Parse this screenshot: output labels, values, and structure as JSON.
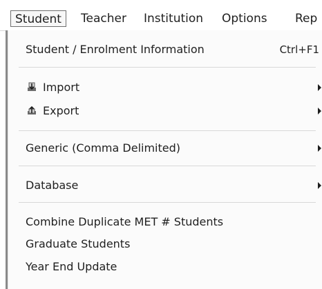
{
  "menubar": {
    "items": [
      {
        "label": "Student"
      },
      {
        "label": "Teacher"
      },
      {
        "label": "Institution"
      },
      {
        "label": "Options"
      },
      {
        "label": "Rep"
      }
    ]
  },
  "student_menu": {
    "items": [
      {
        "label": "Student / Enrolment Information",
        "shortcut": "Ctrl+F1"
      },
      {
        "label": "Import",
        "icon": "import-icon",
        "submenu": true
      },
      {
        "label": "Export",
        "icon": "export-icon",
        "submenu": true
      },
      {
        "label": "Generic (Comma Delimited)",
        "submenu": true
      },
      {
        "label": "Database",
        "submenu": true
      },
      {
        "label": "Combine Duplicate MET # Students"
      },
      {
        "label": "Graduate Students"
      },
      {
        "label": "Year End Update"
      }
    ]
  },
  "colors": {
    "text": "#1f1f1f",
    "menu_background": "#fbfbfb",
    "separator": "#d8d8d8",
    "active_border": "#6f6f6f"
  }
}
